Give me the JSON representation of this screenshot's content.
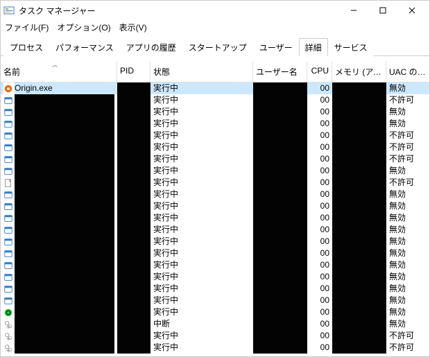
{
  "window": {
    "title": "タスク マネージャー"
  },
  "menu": {
    "file": "ファイル(F)",
    "options": "オプション(O)",
    "view": "表示(V)"
  },
  "tabs": {
    "processes": "プロセス",
    "performance": "パフォーマンス",
    "app_history": "アプリの履歴",
    "startup": "スタートアップ",
    "users": "ユーザー",
    "details": "詳細",
    "services": "サービス"
  },
  "columns": {
    "name": "名前",
    "pid": "PID",
    "status": "状態",
    "user": "ユーザー名",
    "cpu": "CPU",
    "memory": "メモリ (アクテ...",
    "uac": "UAC の仮想化"
  },
  "rows": [
    {
      "icon": "origin",
      "name": "Origin.exe",
      "status": "実行中",
      "cpu": "00",
      "uac": "無効",
      "sel": true
    },
    {
      "icon": "blue",
      "status": "実行中",
      "cpu": "00",
      "uac": "不許可"
    },
    {
      "icon": "blue",
      "status": "実行中",
      "cpu": "00",
      "uac": "無効"
    },
    {
      "icon": "blue",
      "status": "実行中",
      "cpu": "00",
      "uac": "無効"
    },
    {
      "icon": "blue",
      "status": "実行中",
      "cpu": "00",
      "uac": "不許可"
    },
    {
      "icon": "blue",
      "status": "実行中",
      "cpu": "00",
      "uac": "不許可"
    },
    {
      "icon": "blue",
      "status": "実行中",
      "cpu": "00",
      "uac": "不許可"
    },
    {
      "icon": "blue",
      "status": "実行中",
      "cpu": "00",
      "uac": "無効"
    },
    {
      "icon": "doc",
      "status": "実行中",
      "cpu": "00",
      "uac": "不許可"
    },
    {
      "icon": "blue",
      "status": "実行中",
      "cpu": "00",
      "uac": "無効"
    },
    {
      "icon": "blue",
      "status": "実行中",
      "cpu": "00",
      "uac": "無効"
    },
    {
      "icon": "blue",
      "status": "実行中",
      "cpu": "00",
      "uac": "無効"
    },
    {
      "icon": "blue",
      "status": "実行中",
      "cpu": "00",
      "uac": "無効"
    },
    {
      "icon": "blue",
      "status": "実行中",
      "cpu": "00",
      "uac": "無効"
    },
    {
      "icon": "blue",
      "status": "実行中",
      "cpu": "00",
      "uac": "無効"
    },
    {
      "icon": "blue",
      "status": "実行中",
      "cpu": "00",
      "uac": "無効"
    },
    {
      "icon": "blue",
      "status": "実行中",
      "cpu": "00",
      "uac": "無効"
    },
    {
      "icon": "blue",
      "status": "実行中",
      "cpu": "00",
      "uac": "無効"
    },
    {
      "icon": "blue",
      "status": "実行中",
      "cpu": "00",
      "uac": "無効"
    },
    {
      "icon": "green",
      "status": "実行中",
      "cpu": "00",
      "uac": "無効"
    },
    {
      "icon": "gray",
      "status": "中断",
      "cpu": "00",
      "uac": "無効"
    },
    {
      "icon": "gray",
      "status": "実行中",
      "cpu": "00",
      "uac": "不許可"
    },
    {
      "icon": "gray",
      "status": "実行中",
      "cpu": "00",
      "uac": "不許可"
    }
  ]
}
